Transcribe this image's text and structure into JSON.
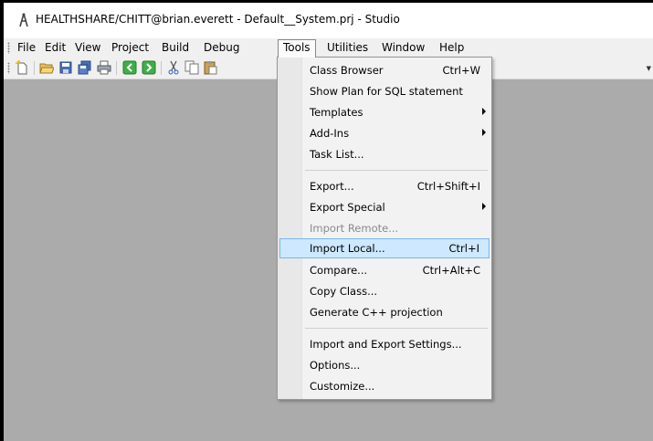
{
  "window": {
    "title": "HEALTHSHARE/CHITT@brian.everett - Default__System.prj - Studio"
  },
  "menubar": {
    "items": [
      "File",
      "Edit",
      "View",
      "Project",
      "Build",
      "Debug",
      "Tools",
      "Utilities",
      "Window",
      "Help"
    ],
    "active": "Tools"
  },
  "tools_menu": {
    "items": [
      {
        "label": "Class Browser",
        "shortcut": "Ctrl+W"
      },
      {
        "label": "Show Plan for SQL statement",
        "shortcut": ""
      },
      {
        "label": "Templates",
        "submenu": true
      },
      {
        "label": "Add-Ins",
        "submenu": true
      },
      {
        "label": "Task List...",
        "shortcut": ""
      },
      {
        "label": "Export...",
        "shortcut": "Ctrl+Shift+I"
      },
      {
        "label": "Export Special",
        "submenu": true
      },
      {
        "label": "Import Remote...",
        "disabled": true
      },
      {
        "label": "Import Local...",
        "shortcut": "Ctrl+I",
        "highlighted": true
      },
      {
        "label": "Compare...",
        "shortcut": "Ctrl+Alt+C"
      },
      {
        "label": "Copy Class...",
        "shortcut": ""
      },
      {
        "label": "Generate C++ projection",
        "shortcut": ""
      },
      {
        "label": "Import and Export Settings...",
        "shortcut": ""
      },
      {
        "label": "Options...",
        "shortcut": ""
      },
      {
        "label": "Customize...",
        "shortcut": ""
      }
    ]
  },
  "toolbar": {
    "icons": [
      "new-icon",
      "open-folder-icon",
      "save-icon",
      "save-all-icon",
      "print-icon",
      "back-icon",
      "forward-icon",
      "cut-icon",
      "copy-icon",
      "paste-icon"
    ]
  },
  "colors": {
    "workspace": "#ababab",
    "menu_highlight": "#cde8ff",
    "menu_highlight_border": "#7eb4ea",
    "disabled_text": "#8a8a8a"
  }
}
